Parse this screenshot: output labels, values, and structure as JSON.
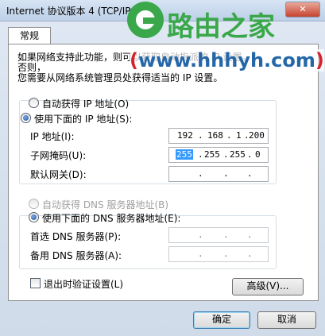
{
  "window": {
    "title": "Internet 协议版本 4 (TCP/IP",
    "close_label": "✕"
  },
  "tabs": [
    {
      "label": "常规"
    }
  ],
  "description": {
    "line1": "如果网络支持此功能，则可以获取自动指派的 IP 设置。否则，",
    "line2": "您需要从网络系统管理员处获得适当的 IP 设置。"
  },
  "ip_section": {
    "auto_label": "自动获得 IP 地址(O)",
    "manual_label": "使用下面的 IP 地址(S):",
    "selected": "manual",
    "fields": [
      {
        "label": "IP 地址(I):",
        "octets": [
          "192",
          "168",
          "1",
          "200"
        ],
        "dots": [
          ".",
          ".",
          "."
        ]
      },
      {
        "label": "子网掩码(U):",
        "octets": [
          "255",
          "255",
          "255",
          "0"
        ],
        "dots": [
          ".",
          ".",
          "."
        ]
      },
      {
        "label": "默认网关(D):",
        "octets": [
          "",
          "",
          "",
          ""
        ],
        "dots": [
          ".",
          ".",
          "."
        ]
      }
    ]
  },
  "dns_section": {
    "auto_label": "自动获得 DNS 服务器地址(B)",
    "manual_label": "使用下面的 DNS 服务器地址(E):",
    "selected": "manual",
    "fields": [
      {
        "label": "首选 DNS 服务器(P):",
        "octets": [
          "",
          "",
          "",
          ""
        ],
        "dots": [
          ".",
          ".",
          "."
        ]
      },
      {
        "label": "备用 DNS 服务器(A):",
        "octets": [
          "",
          "",
          "",
          ""
        ],
        "dots": [
          ".",
          ".",
          "."
        ]
      }
    ]
  },
  "validate_label": "退出时验证设置(L)",
  "advanced_label": "高级(V)...",
  "ok_label": "确定",
  "cancel_label": "取消",
  "watermark": {
    "title": "路由之家",
    "url_open": "(",
    "url": "www.hhhyh.com",
    "url_close": ")"
  },
  "colors": {
    "watermark_green": "#3aa84a",
    "watermark_blue": "#2467a8",
    "selection": "#3399ff"
  }
}
